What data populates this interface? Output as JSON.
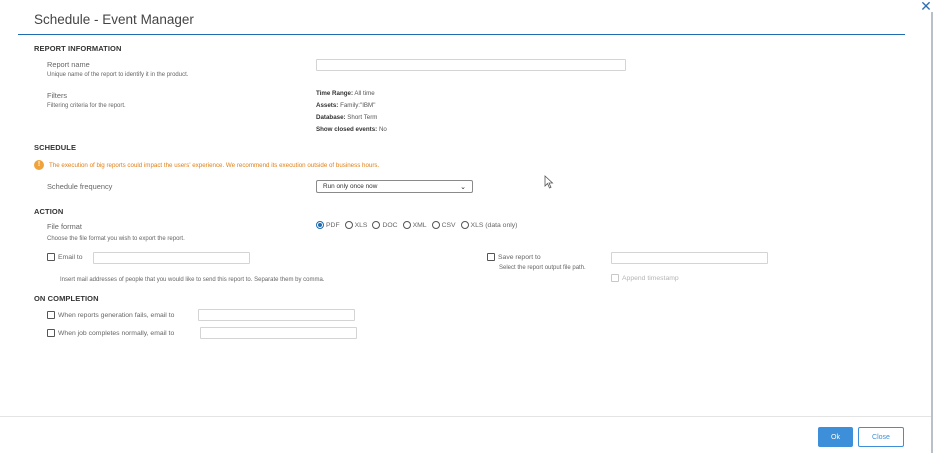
{
  "dialog": {
    "title": "Schedule - Event Manager",
    "close_glyph": "✕"
  },
  "report_information": {
    "heading": "REPORT INFORMATION",
    "report_name_label": "Report name",
    "report_name_hint": "Unique name of the report to identify it in the product.",
    "report_name_value": "",
    "filters_label": "Filters",
    "filters_hint": "Filtering criteria for the report.",
    "filters": [
      {
        "key": "Time Range:",
        "value": " All time"
      },
      {
        "key": "Assets:",
        "value": " Family:\"IBM\""
      },
      {
        "key": "Database:",
        "value": " Short Term"
      },
      {
        "key": "Show closed events:",
        "value": " No"
      }
    ]
  },
  "schedule": {
    "heading": "SCHEDULE",
    "warning_icon": "!",
    "warning": "The execution of big reports could impact the users' experience. We recommend its execution outside of business hours.",
    "frequency_label": "Schedule frequency",
    "frequency_value": "Run only once now"
  },
  "action": {
    "heading": "ACTION",
    "file_format_label": "File format",
    "file_format_hint": "Choose the file format you wish to export the report.",
    "formats": [
      "PDF",
      "XLS",
      "DOC",
      "XML",
      "CSV",
      "XLS (data only)"
    ],
    "selected_format": "PDF",
    "email_to_label": "Email to",
    "email_hint": "Insert mail addresses of people that you would like to send this report to. Separate them by comma.",
    "save_report_label": "Save report to",
    "save_report_hint": "Select the report output file path.",
    "append_timestamp_label": "Append timestamp"
  },
  "on_completion": {
    "heading": "ON COMPLETION",
    "fail_label": "When reports generation fails, email to",
    "complete_label": "When job completes normally, email to"
  },
  "footer": {
    "ok_label": "Ok",
    "close_label": "Close"
  },
  "colors": {
    "accent": "#1f6cb2",
    "ok_button": "#3d8fd9",
    "warning": "#e07f16"
  }
}
